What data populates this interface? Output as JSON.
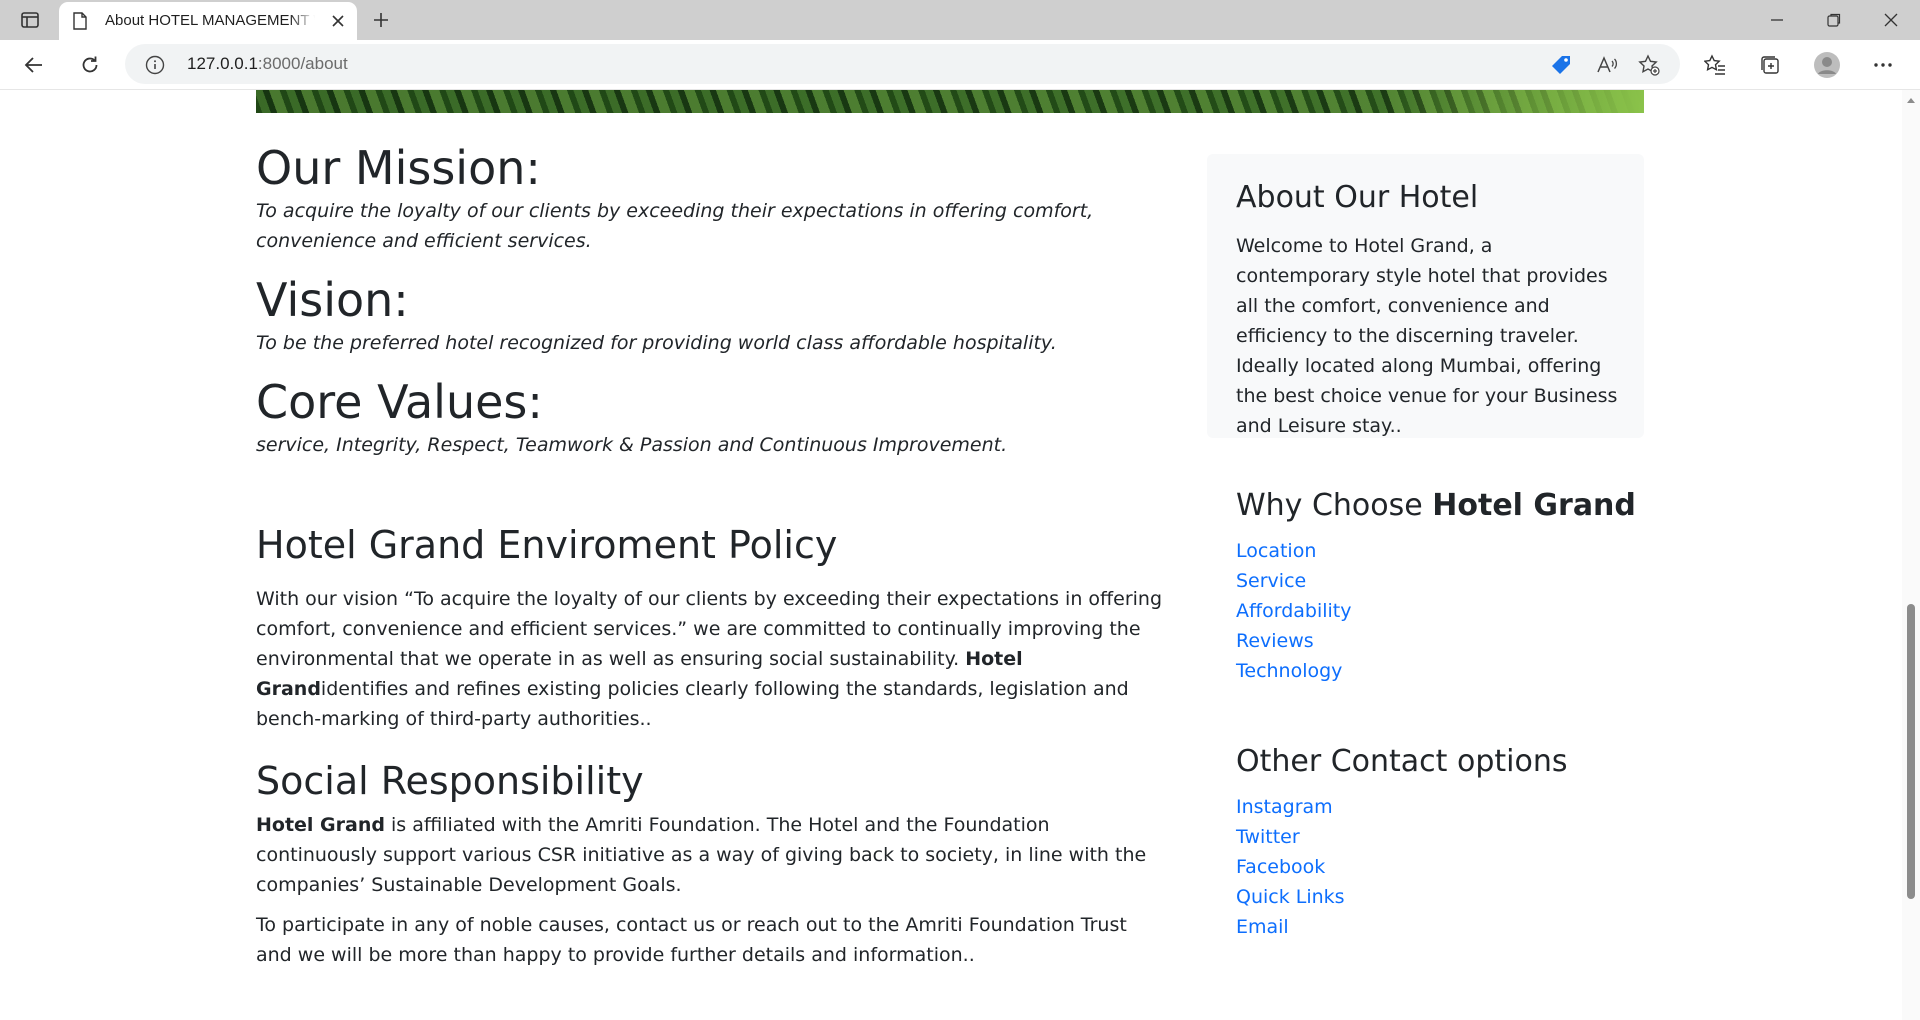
{
  "browser": {
    "tab_title": "About HOTEL MANAGEMENT WEBSITE",
    "url_host": "127.0.0.1",
    "url_rest": ":8000/about"
  },
  "main": {
    "mission_heading": "Our Mission:",
    "mission_text": "To acquire the loyalty of our clients by exceeding their expectations in offering comfort, convenience and efficient services.",
    "vision_heading": "Vision:",
    "vision_text": "To be the preferred hotel recognized for providing world class affordable hospitality.",
    "values_heading": "Core Values:",
    "values_text": "service, Integrity, Respect, Teamwork & Passion and Continuous Improvement.",
    "policy_heading": "Hotel Grand Enviroment Policy",
    "policy_text_1": "With our vision “To acquire the loyalty of our clients by exceeding their expectations in offering comfort, convenience and efficient services.” we are committed to continually improving the environmental that we operate in as well as ensuring social sustainability. ",
    "policy_bold": "Hotel Grand",
    "policy_text_2": "identifies and refines existing policies clearly following the standards, legislation and bench-marking of third-party authorities..",
    "social_heading": "Social Responsibility",
    "social_bold": "Hotel Grand",
    "social_text": " is affiliated with the Amriti Foundation. The Hotel and the Foundation continuously support various CSR initiative as a way of giving back to society, in line with the companies’ Sustainable Development Goals.",
    "social_text_2": "To participate in any of noble causes, contact us or reach out to the Amriti Foundation Trust and we will be more than happy to provide further details and information.."
  },
  "sidebar": {
    "about_heading": "About Our Hotel",
    "about_text": "Welcome to Hotel Grand, a contemporary style hotel that provides all the comfort, convenience and efficiency to the discerning traveler. Ideally located along Mumbai, offering the best choice venue for your Business and Leisure stay..",
    "why_heading_prefix": "Why Choose ",
    "why_heading_bold": "Hotel Grand",
    "why_links": [
      "Location",
      "Service",
      "Affordability",
      "Reviews",
      "Technology"
    ],
    "contact_heading": "Other Contact options",
    "contact_links": [
      "Instagram",
      "Twitter",
      "Facebook",
      "Quick Links",
      "Email"
    ]
  },
  "colors": {
    "link": "#0d6efd",
    "text": "#212529",
    "card_bg": "#f8f9fa"
  }
}
